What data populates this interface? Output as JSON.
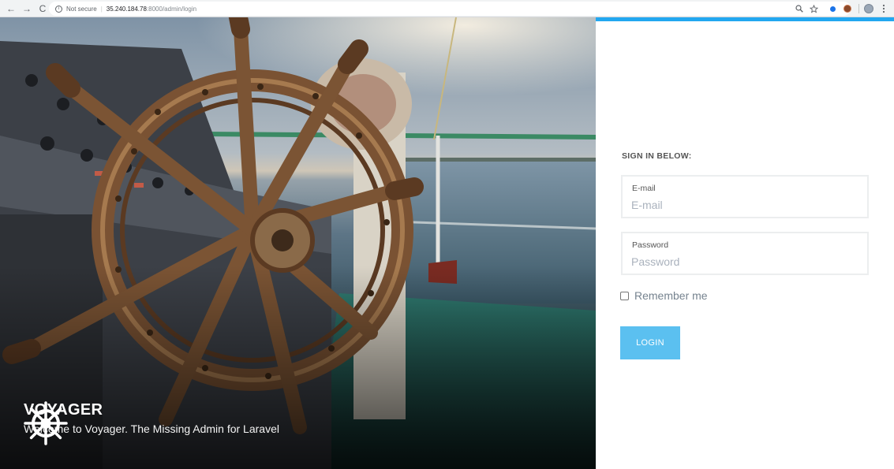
{
  "browser": {
    "back_glyph": "←",
    "forward_glyph": "→",
    "reload_glyph": "C",
    "info_glyph": "i",
    "security_label": "Not secure",
    "separator": "|",
    "url_host": "35.240.184.78",
    "url_path": ":8000/admin/login",
    "icons": [
      "back-icon",
      "forward-icon",
      "reload-icon",
      "info-icon",
      "zoom-icon",
      "star-icon",
      "extension-icon",
      "profile-avatar",
      "menu-icon"
    ]
  },
  "hero": {
    "brand_title": "VOYAGER",
    "brand_tagline": "Welcome to Voyager. The Missing Admin for Laravel"
  },
  "login": {
    "heading": "SIGN IN BELOW:",
    "email": {
      "label": "E-mail",
      "placeholder": "E-mail",
      "value": ""
    },
    "password": {
      "label": "Password",
      "placeholder": "Password",
      "value": ""
    },
    "remember_label": "Remember me",
    "remember_checked": false,
    "submit_label": "LOGIN"
  },
  "colors": {
    "accent": "#22a7f0",
    "button": "#5bc0f0",
    "label_text": "#555555",
    "muted_text": "#76838f"
  }
}
